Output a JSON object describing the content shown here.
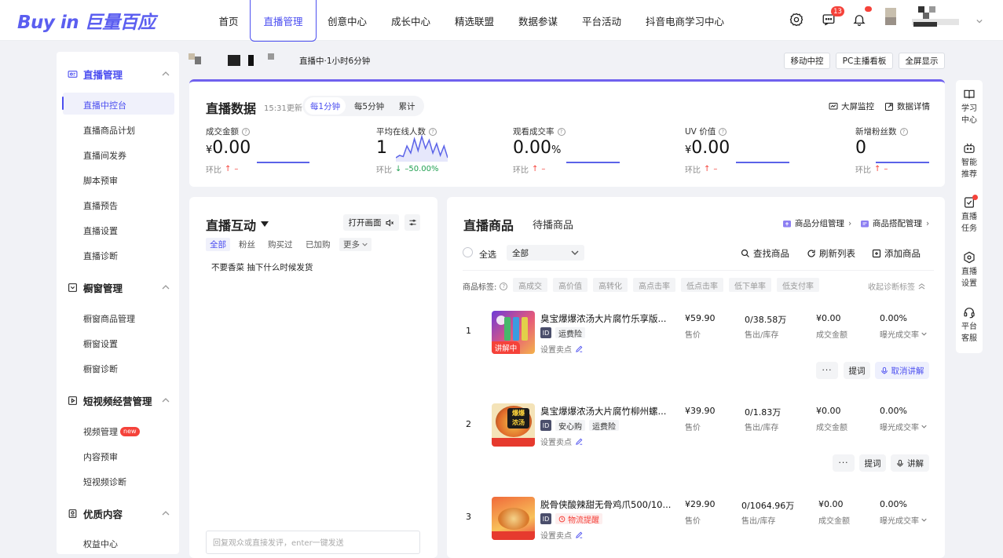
{
  "brand": {
    "logo_text": "Buy in 巨量百应",
    "accent": "#4c4ff0"
  },
  "nav": {
    "items": [
      {
        "label": "首页",
        "active": false
      },
      {
        "label": "直播管理",
        "active": true
      },
      {
        "label": "创意中心",
        "active": false
      },
      {
        "label": "成长中心",
        "active": false
      },
      {
        "label": "精选联盟",
        "active": false
      },
      {
        "label": "数据参谋",
        "active": false
      },
      {
        "label": "平台活动",
        "active": false
      },
      {
        "label": "抖音电商学习中心",
        "active": false
      }
    ],
    "message_count": "13"
  },
  "sidebar": {
    "sections": [
      {
        "title": "直播管理",
        "icon": "live-icon",
        "items": [
          "直播中控台",
          "直播商品计划",
          "直播间发券",
          "脚本预审",
          "直播预告",
          "直播设置",
          "直播诊断"
        ]
      },
      {
        "title": "橱窗管理",
        "icon": "window-icon",
        "items": [
          "橱窗商品管理",
          "橱窗设置",
          "橱窗诊断"
        ]
      },
      {
        "title": "短视频经营管理",
        "icon": "video-icon",
        "items": [
          "视频管理",
          "内容预审",
          "短视频诊断"
        ],
        "new_label": "new"
      },
      {
        "title": "优质内容",
        "icon": "content-icon",
        "items": [
          "权益中心"
        ]
      }
    ],
    "selected": "直播中控台"
  },
  "live_header": {
    "status": "直播中·1小时6分钟",
    "buttons": [
      "移动中控",
      "PC主播看板",
      "全屏显示"
    ]
  },
  "data_card": {
    "title": "直播数据",
    "update_time": "15:31更新",
    "tabs": [
      "每1分钟",
      "每5分钟",
      "累计"
    ],
    "active_tab": "每1分钟",
    "links": [
      "大屏监控",
      "数据详情"
    ],
    "compare_label": "环比",
    "metrics": [
      {
        "label": "成交金额",
        "currency": "¥",
        "value": "0.00",
        "change": "–",
        "dir": "up"
      },
      {
        "label": "平均在线人数",
        "currency": "",
        "value": "1",
        "change": "–50.00%",
        "dir": "down"
      },
      {
        "label": "观看成交率",
        "currency": "",
        "value": "0.00",
        "unit": "%",
        "change": "–",
        "dir": "up"
      },
      {
        "label": "UV 价值",
        "currency": "¥",
        "value": "0.00",
        "change": "–",
        "dir": "up"
      },
      {
        "label": "新增粉丝数",
        "currency": "",
        "value": "0",
        "change": "–",
        "dir": "up"
      }
    ],
    "online_sparkline": [
      0.1,
      0.2,
      0.15,
      0.6,
      0.3,
      0.9,
      0.4,
      1.0,
      0.5,
      0.85,
      0.3,
      0.7,
      0.2,
      0.6,
      0.1
    ]
  },
  "interaction": {
    "title": "直播互动",
    "open_button": "打开画面",
    "filters": [
      "全部",
      "粉丝",
      "购买过",
      "已加购",
      "更多"
    ],
    "active_filter": "全部",
    "comments": [
      "不要香菜 抽下什么时候发货"
    ],
    "input_placeholder": "回复观众或直接发评，enter一键发送"
  },
  "products": {
    "tabs": [
      "直播商品",
      "待播商品"
    ],
    "active_tab": "直播商品",
    "header_links": [
      "商品分组管理",
      "商品搭配管理"
    ],
    "select_all": "全选",
    "group_select": "全部",
    "actions": [
      "查找商品",
      "刷新列表",
      "添加商品"
    ],
    "tag_label": "商品标签:",
    "tags": [
      "高成交",
      "高价值",
      "高转化",
      "高点击率",
      "低点击率",
      "低下单率",
      "低支付率"
    ],
    "collapse_label": "收起诊断标签",
    "col_labels": {
      "price": "售价",
      "sold": "售出/库存",
      "gmv": "成交金额",
      "ctr": "曝光成交率"
    },
    "edit_label": "设置卖点",
    "items": [
      {
        "index": "1",
        "name": "臭宝爆爆浓汤大片腐竹乐享版...",
        "price": "¥59.90",
        "sold": "0/38.58万",
        "gmv": "¥0.00",
        "ctr": "0.00%",
        "chips": [
          "运费险"
        ],
        "badge": "讲解中",
        "buttons": [
          "提词",
          "取消讲解"
        ]
      },
      {
        "index": "2",
        "name": "臭宝爆爆浓汤大片腐竹柳州螺...",
        "price": "¥39.90",
        "sold": "0/1.83万",
        "gmv": "¥0.00",
        "ctr": "0.00%",
        "chips": [
          "安心购",
          "运费险"
        ],
        "buttons": [
          "提词",
          "讲解"
        ]
      },
      {
        "index": "3",
        "name": "脱骨侠酸辣甜无骨鸡爪500/10...",
        "price": "¥29.90",
        "sold": "0/1064.96万",
        "gmv": "¥0.00",
        "ctr": "0.00%",
        "chips": [
          "物流提醒"
        ],
        "buttons": []
      }
    ]
  },
  "rail": {
    "items": [
      [
        "学习",
        "中心"
      ],
      [
        "智能",
        "推荐"
      ],
      [
        "直播",
        "任务"
      ],
      [
        "直播",
        "设置"
      ],
      [
        "平台",
        "客服"
      ]
    ]
  }
}
